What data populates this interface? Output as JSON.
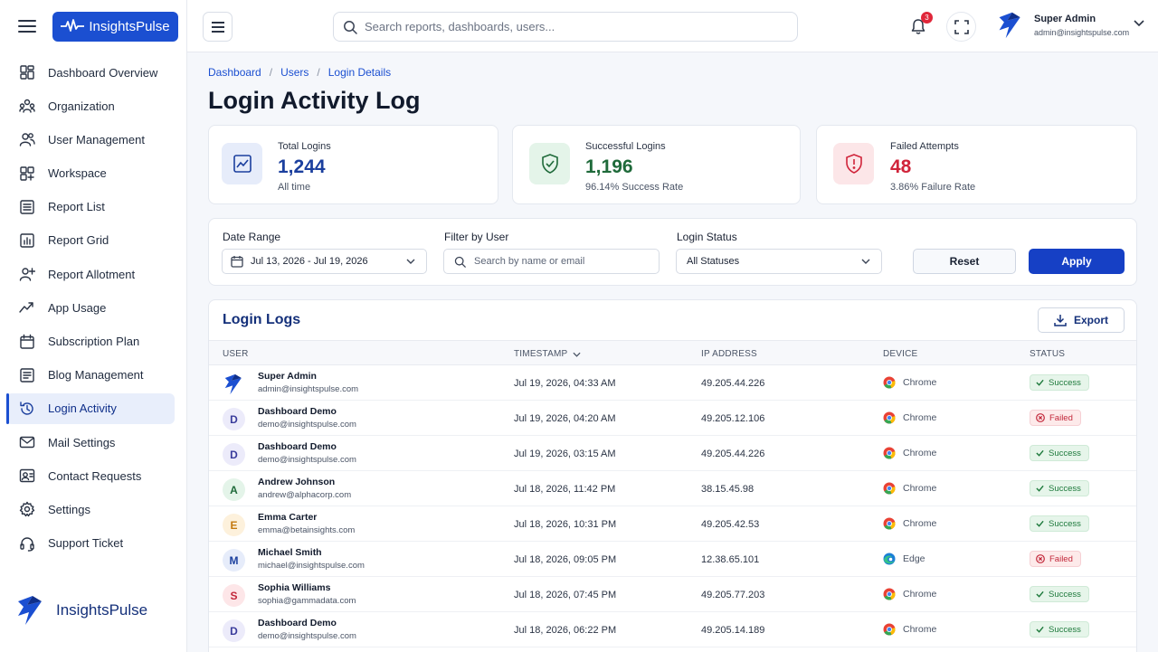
{
  "brand": {
    "name": "InsightsPulse"
  },
  "search": {
    "placeholder": "Search reports, dashboards, users..."
  },
  "notifications": {
    "count": "3"
  },
  "user": {
    "name": "Super Admin",
    "email": "admin@insightspulse.com"
  },
  "sidebar": {
    "items": [
      {
        "label": "Dashboard Overview",
        "icon": "dashboard-icon"
      },
      {
        "label": "Organization",
        "icon": "organization-icon"
      },
      {
        "label": "User Management",
        "icon": "users-icon"
      },
      {
        "label": "Workspace",
        "icon": "workspace-icon"
      },
      {
        "label": "Report List",
        "icon": "list-icon"
      },
      {
        "label": "Report Grid",
        "icon": "grid-icon"
      },
      {
        "label": "Report Allotment",
        "icon": "user-plus-icon"
      },
      {
        "label": "App Usage",
        "icon": "trend-icon"
      },
      {
        "label": "Subscription Plan",
        "icon": "calendar-icon"
      },
      {
        "label": "Blog Management",
        "icon": "blog-icon"
      },
      {
        "label": "Login Activity",
        "icon": "history-icon",
        "active": true
      },
      {
        "label": "Mail Settings",
        "icon": "mail-icon"
      },
      {
        "label": "Contact Requests",
        "icon": "contact-icon"
      },
      {
        "label": "Settings",
        "icon": "gear-icon"
      },
      {
        "label": "Support Ticket",
        "icon": "headset-icon"
      }
    ],
    "footer_brand": "InsightsPulse"
  },
  "breadcrumb": [
    "Dashboard",
    "Users",
    "Login Details"
  ],
  "page": {
    "title": "Login Activity Log"
  },
  "stats": [
    {
      "label": "Total Logins",
      "value": "1,244",
      "sub": "All time",
      "color": "#1b3f9e"
    },
    {
      "label": "Successful Logins",
      "value": "1,196",
      "sub": "96.14% Success Rate",
      "color": "#1f6a3a"
    },
    {
      "label": "Failed Attempts",
      "value": "48",
      "sub": "3.86% Failure Rate",
      "color": "#d0243a"
    }
  ],
  "filters": {
    "date_label": "Date Range",
    "date_value": "Jul 13, 2026 - Jul 19, 2026",
    "user_label": "Filter by User",
    "user_placeholder": "Search by name or email",
    "status_label": "Login Status",
    "status_value": "All Statuses",
    "reset": "Reset",
    "apply": "Apply"
  },
  "logs": {
    "title": "Login Logs",
    "export": "Export",
    "columns": [
      "USER",
      "TIMESTAMP",
      "IP ADDRESS",
      "DEVICE",
      "STATUS"
    ],
    "rows": [
      {
        "initial": "",
        "logo": true,
        "name": "Super Admin",
        "email": "admin@insightspulse.com",
        "timestamp": "Jul 19, 2026, 04:33 AM",
        "ip": "49.205.44.226",
        "device": "Chrome",
        "status": "Success"
      },
      {
        "initial": "D",
        "name": "Dashboard Demo",
        "email": "demo@insightspulse.com",
        "timestamp": "Jul 19, 2026, 04:20 AM",
        "ip": "49.205.12.106",
        "device": "Chrome",
        "status": "Failed"
      },
      {
        "initial": "D",
        "name": "Dashboard Demo",
        "email": "demo@insightspulse.com",
        "timestamp": "Jul 19, 2026, 03:15 AM",
        "ip": "49.205.44.226",
        "device": "Chrome",
        "status": "Success"
      },
      {
        "initial": "A",
        "name": "Andrew Johnson",
        "email": "andrew@alphacorp.com",
        "timestamp": "Jul 18, 2026, 11:42 PM",
        "ip": "38.15.45.98",
        "device": "Chrome",
        "status": "Success"
      },
      {
        "initial": "E",
        "name": "Emma Carter",
        "email": "emma@betainsights.com",
        "timestamp": "Jul 18, 2026, 10:31 PM",
        "ip": "49.205.42.53",
        "device": "Chrome",
        "status": "Success"
      },
      {
        "initial": "M",
        "name": "Michael Smith",
        "email": "michael@insightspulse.com",
        "timestamp": "Jul 18, 2026, 09:05 PM",
        "ip": "12.38.65.101",
        "device": "Edge",
        "status": "Failed"
      },
      {
        "initial": "S",
        "name": "Sophia Williams",
        "email": "sophia@gammadata.com",
        "timestamp": "Jul 18, 2026, 07:45 PM",
        "ip": "49.205.77.203",
        "device": "Chrome",
        "status": "Success"
      },
      {
        "initial": "D",
        "name": "Dashboard Demo",
        "email": "demo@insightspulse.com",
        "timestamp": "Jul 18, 2026, 06:22 PM",
        "ip": "49.205.14.189",
        "device": "Chrome",
        "status": "Success"
      }
    ]
  }
}
